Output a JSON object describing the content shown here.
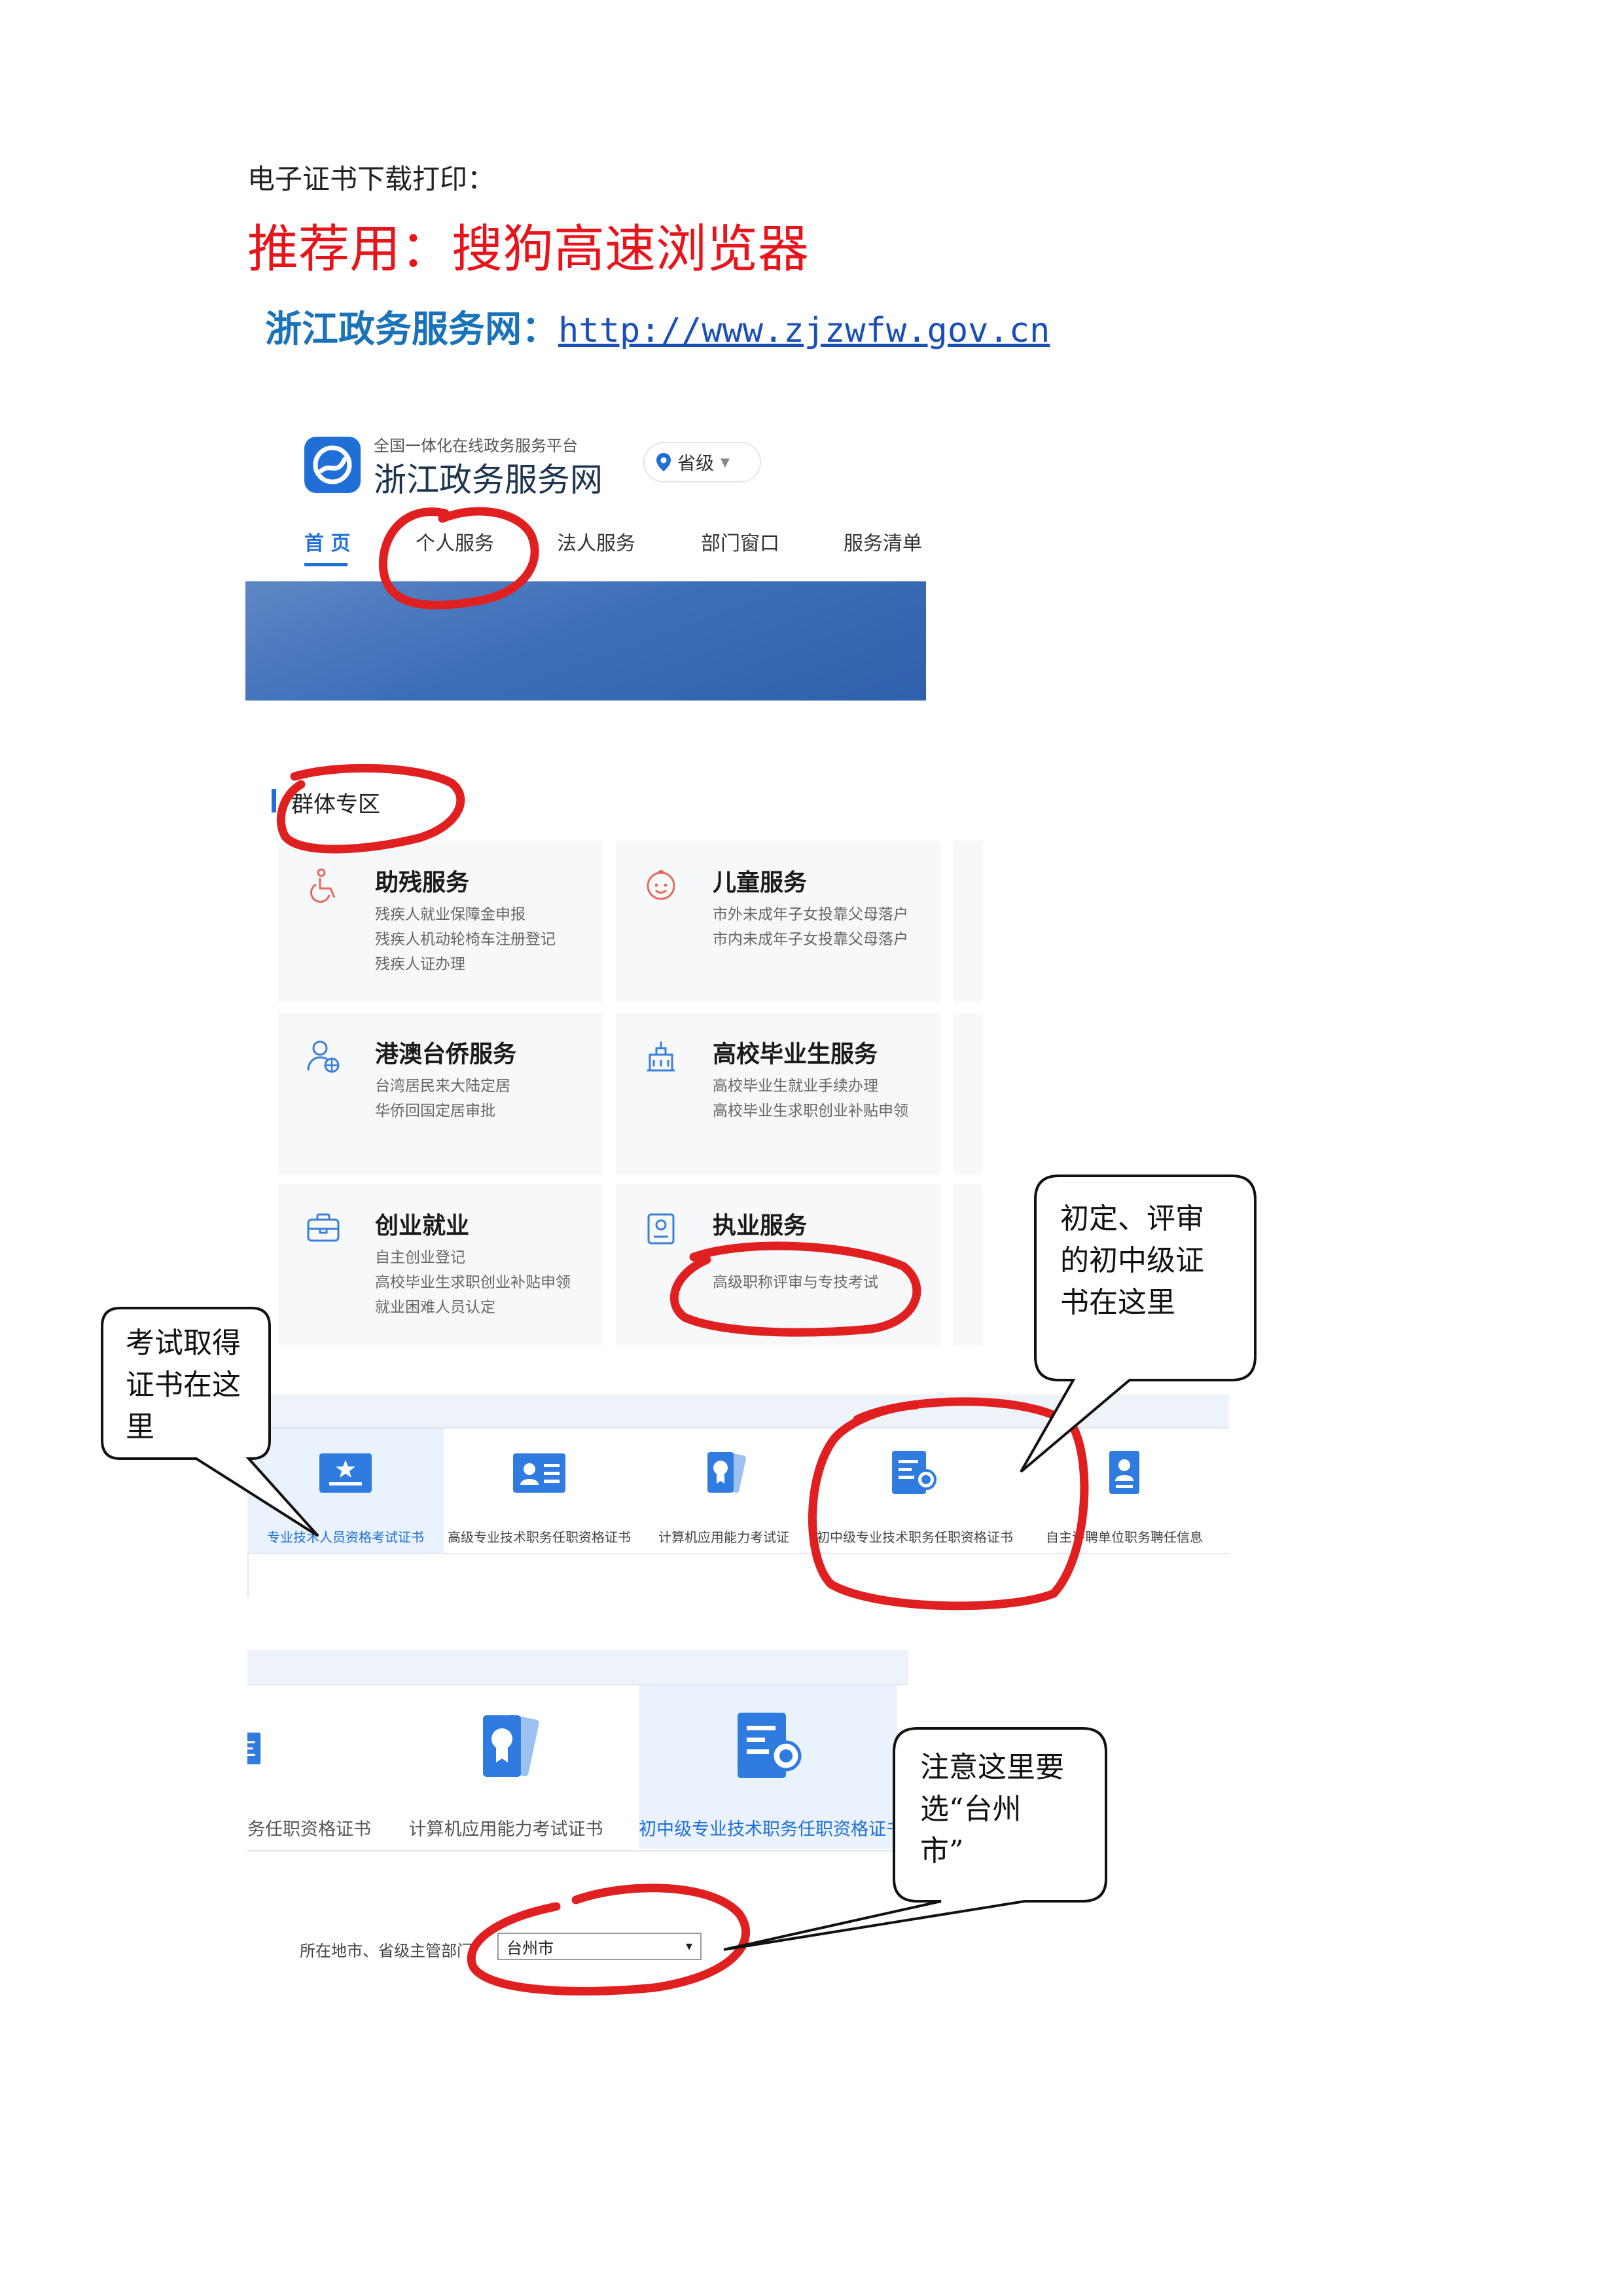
{
  "document": {
    "intro": "电子证书下载打印：",
    "recommend": "推荐用：搜狗高速浏览器",
    "site_label": "浙江政务服务网：",
    "site_url": "http://www.zjzwfw.gov.cn"
  },
  "portal": {
    "logo_subtitle": "全国一体化在线政务服务平台",
    "logo_title": "浙江政务服务网",
    "region": "省级",
    "nav": {
      "home": "首 页",
      "personal": "个人服务",
      "legal": "法人服务",
      "dept": "部门窗口",
      "list": "服务清单"
    }
  },
  "groups": {
    "title": "群体专区",
    "cards": [
      {
        "title": "助残服务",
        "lines": [
          "残疾人就业保障金申报",
          "残疾人机动轮椅车注册登记",
          "残疾人证办理"
        ],
        "icon": "wheelchair-icon"
      },
      {
        "title": "儿童服务",
        "lines": [
          "市外未成年子女投靠父母落户",
          "市内未成年子女投靠父母落户"
        ],
        "icon": "child-face-icon"
      },
      {
        "title": "港澳台侨服务",
        "lines": [
          "台湾居民来大陆定居",
          "华侨回国定居审批"
        ],
        "icon": "person-globe-icon"
      },
      {
        "title": "高校毕业生服务",
        "lines": [
          "高校毕业生就业手续办理",
          "高校毕业生求职创业补贴申领"
        ],
        "icon": "school-building-icon"
      },
      {
        "title": "创业就业",
        "lines": [
          "自主创业登记",
          "高校毕业生求职创业补贴申领",
          "就业困难人员认定"
        ],
        "icon": "briefcase-icon"
      },
      {
        "title": "执业服务",
        "lines": [
          "",
          "高级职称评审与专技考试"
        ],
        "icon": "id-badge-icon"
      }
    ]
  },
  "certs": {
    "tabs": [
      "专业技术人员资格考试证书",
      "高级专业技术职务任职资格证书",
      "计算机应用能力考试证书",
      "初中级专业技术职务任职资格证书",
      "自主评聘单位职务聘任信息"
    ],
    "tabs_display": [
      "专业技术人员资格考试证书",
      "高级专业技术职务任职资格证书",
      "计算机应用能力考试证",
      "初中级专业技术职务任职资格证书",
      "自主评聘单位职务聘任信息"
    ]
  },
  "select_panel": {
    "tab_partial": "务任职资格证书",
    "tab_computer": "计算机应用能力考试证书",
    "tab_selected": "初中级专业技术职务任职资格证书",
    "location_label": "所在地市、省级主管部门",
    "location_value": "台州市"
  },
  "callouts": {
    "exam": [
      "考试取得",
      "证书在这",
      "里"
    ],
    "intermediate": [
      "初定、评审",
      "的初中级证",
      "书在这里"
    ],
    "taizhou": [
      "注意这里要",
      "选“台州",
      "市”"
    ]
  },
  "colors": {
    "accent": "#1f6fd6",
    "annotation_red": "#e02020",
    "recommend_red": "#e8141c"
  }
}
